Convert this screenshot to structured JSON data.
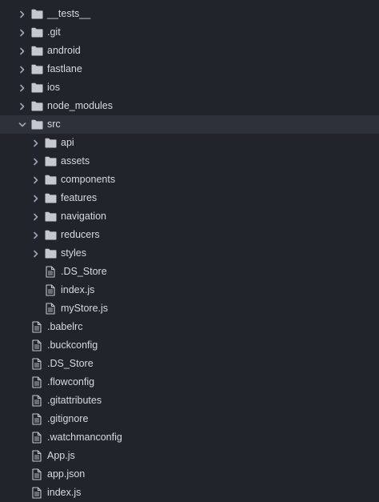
{
  "colors": {
    "background": "#21252b",
    "selected_row": "#2c313a",
    "text": "#d7dae0",
    "icon": "#c5c8ce",
    "chevron": "#9da5b4"
  },
  "tree": [
    {
      "name": "__tests__",
      "type": "folder",
      "depth": 0,
      "expanded": false
    },
    {
      "name": ".git",
      "type": "folder",
      "depth": 0,
      "expanded": false
    },
    {
      "name": "android",
      "type": "folder",
      "depth": 0,
      "expanded": false
    },
    {
      "name": "fastlane",
      "type": "folder",
      "depth": 0,
      "expanded": false
    },
    {
      "name": "ios",
      "type": "folder",
      "depth": 0,
      "expanded": false
    },
    {
      "name": "node_modules",
      "type": "folder",
      "depth": 0,
      "expanded": false
    },
    {
      "name": "src",
      "type": "folder",
      "depth": 0,
      "expanded": true,
      "selected": true
    },
    {
      "name": "api",
      "type": "folder",
      "depth": 1,
      "expanded": false
    },
    {
      "name": "assets",
      "type": "folder",
      "depth": 1,
      "expanded": false
    },
    {
      "name": "components",
      "type": "folder",
      "depth": 1,
      "expanded": false
    },
    {
      "name": "features",
      "type": "folder",
      "depth": 1,
      "expanded": false
    },
    {
      "name": "navigation",
      "type": "folder",
      "depth": 1,
      "expanded": false
    },
    {
      "name": "reducers",
      "type": "folder",
      "depth": 1,
      "expanded": false
    },
    {
      "name": "styles",
      "type": "folder",
      "depth": 1,
      "expanded": false
    },
    {
      "name": ".DS_Store",
      "type": "file",
      "depth": 1
    },
    {
      "name": "index.js",
      "type": "file",
      "depth": 1
    },
    {
      "name": "myStore.js",
      "type": "file",
      "depth": 1
    },
    {
      "name": ".babelrc",
      "type": "file",
      "depth": 0
    },
    {
      "name": ".buckconfig",
      "type": "file",
      "depth": 0
    },
    {
      "name": ".DS_Store",
      "type": "file",
      "depth": 0
    },
    {
      "name": ".flowconfig",
      "type": "file",
      "depth": 0
    },
    {
      "name": ".gitattributes",
      "type": "file",
      "depth": 0
    },
    {
      "name": ".gitignore",
      "type": "file",
      "depth": 0
    },
    {
      "name": ".watchmanconfig",
      "type": "file",
      "depth": 0
    },
    {
      "name": "App.js",
      "type": "file",
      "depth": 0
    },
    {
      "name": "app.json",
      "type": "file",
      "depth": 0
    },
    {
      "name": "index.js",
      "type": "file",
      "depth": 0
    }
  ]
}
